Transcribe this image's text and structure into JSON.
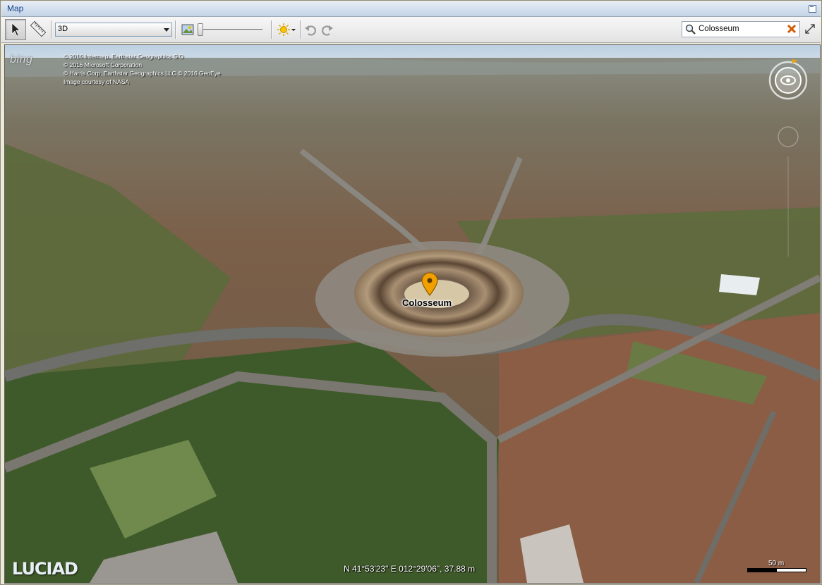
{
  "window": {
    "title": "Map"
  },
  "toolbar": {
    "view_mode": "3D",
    "search_value": "Colosseum"
  },
  "map": {
    "provider_logo": "bing",
    "copyright_lines": [
      "© 2016 Intermap, Earthstar Geographics  SIO",
      "© 2016 Microsoft Corporation",
      "© Harris Corp, Earthstar Geographics LLC  © 2016 GeoEye",
      "Image courtesy of NASA"
    ],
    "placemark_label": "Colosseum",
    "coordinates": "N 41°53'23\" E 012°29'06\", 37.88 m",
    "scale_label": "50 m",
    "brand": "LUCIAD"
  },
  "colors": {
    "titlebar_text": "#15428b",
    "pin": "#f0a000",
    "sky": "#c9d9e8"
  },
  "icons": [
    "select-arrow-icon",
    "measure-ruler-icon",
    "layer-image-icon",
    "sun-icon",
    "undo-icon",
    "redo-icon",
    "search-icon",
    "clear-icon",
    "expand-icon",
    "compass-icon",
    "pin-icon"
  ]
}
